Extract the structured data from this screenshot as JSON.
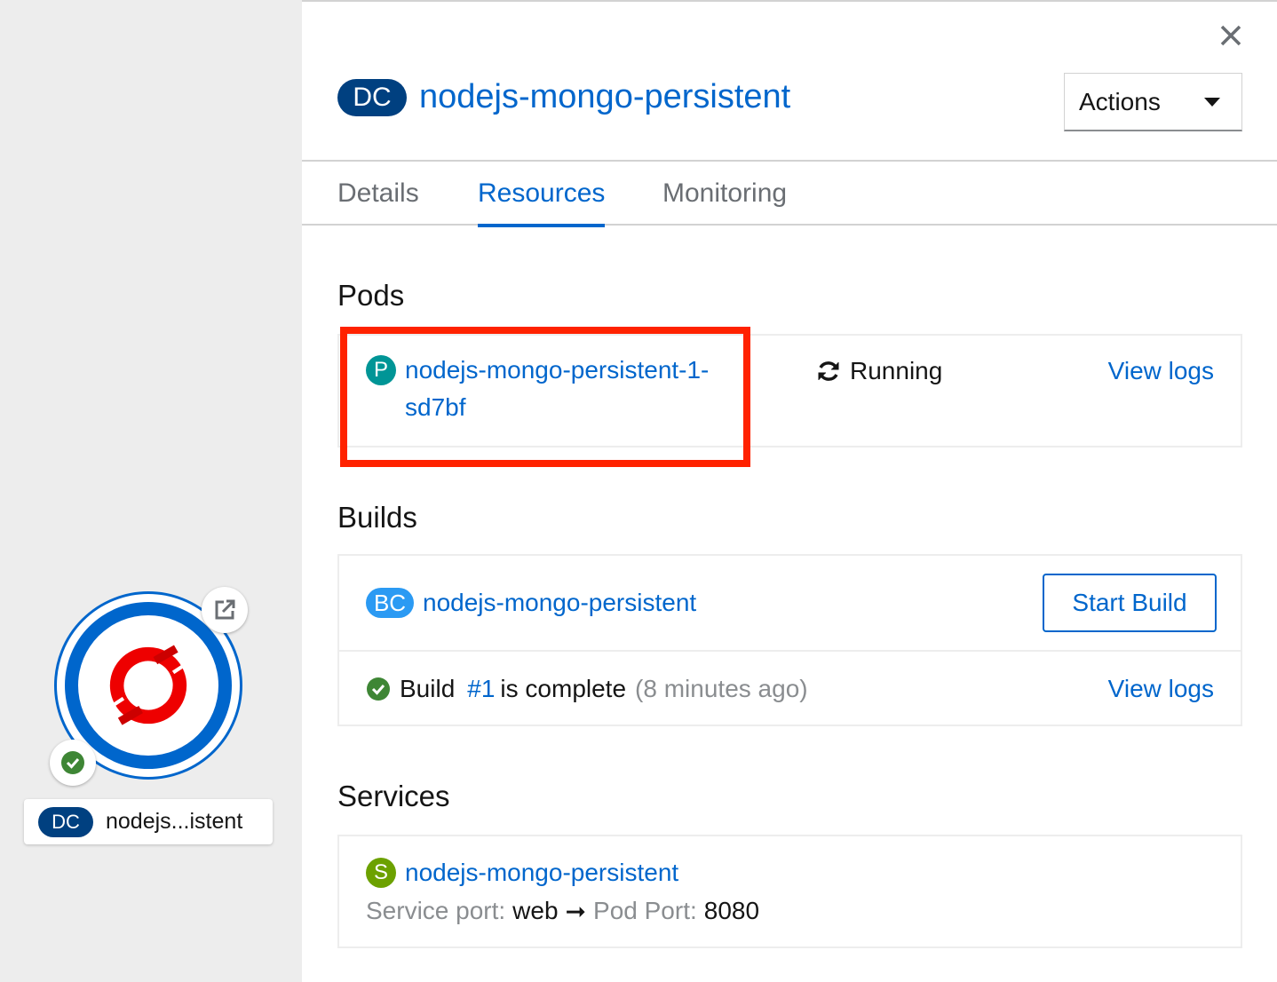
{
  "topology": {
    "node_badge": "DC",
    "node_label": "nodejs...istent",
    "node_status": "success",
    "icons": {
      "link": "external-link-icon",
      "status": "check-circle-icon",
      "logo": "openshift-logo"
    }
  },
  "panel": {
    "badge": "DC",
    "title": "nodejs-mongo-persistent",
    "actions_label": "Actions",
    "close_icon": "close-icon",
    "tabs": [
      {
        "label": "Details",
        "active": false
      },
      {
        "label": "Resources",
        "active": true
      },
      {
        "label": "Monitoring",
        "active": false
      }
    ]
  },
  "pods": {
    "heading": "Pods",
    "badge": "P",
    "name_line1": "nodejs-mongo-persistent-1-",
    "name_line2": "sd7bf",
    "status": "Running",
    "status_icon": "sync-icon",
    "view_logs": "View logs"
  },
  "builds": {
    "heading": "Builds",
    "badge": "BC",
    "name": "nodejs-mongo-persistent",
    "start_build": "Start Build",
    "build_prefix": "Build",
    "build_number": "#1",
    "build_status": "is complete",
    "build_time": "(8 minutes ago)",
    "view_logs": "View logs"
  },
  "services": {
    "heading": "Services",
    "badge": "S",
    "name": "nodejs-mongo-persistent",
    "service_port_label": "Service port:",
    "service_port_value": "web",
    "arrow": "➞",
    "pod_port_label": "Pod Port:",
    "pod_port_value": "8080"
  },
  "colors": {
    "link": "#0066cc",
    "dc_badge": "#004080",
    "pod_badge": "#009596",
    "bc_badge": "#2b9af3",
    "service_badge": "#6ca100",
    "success": "#3e8635",
    "highlight": "#ff2200"
  }
}
